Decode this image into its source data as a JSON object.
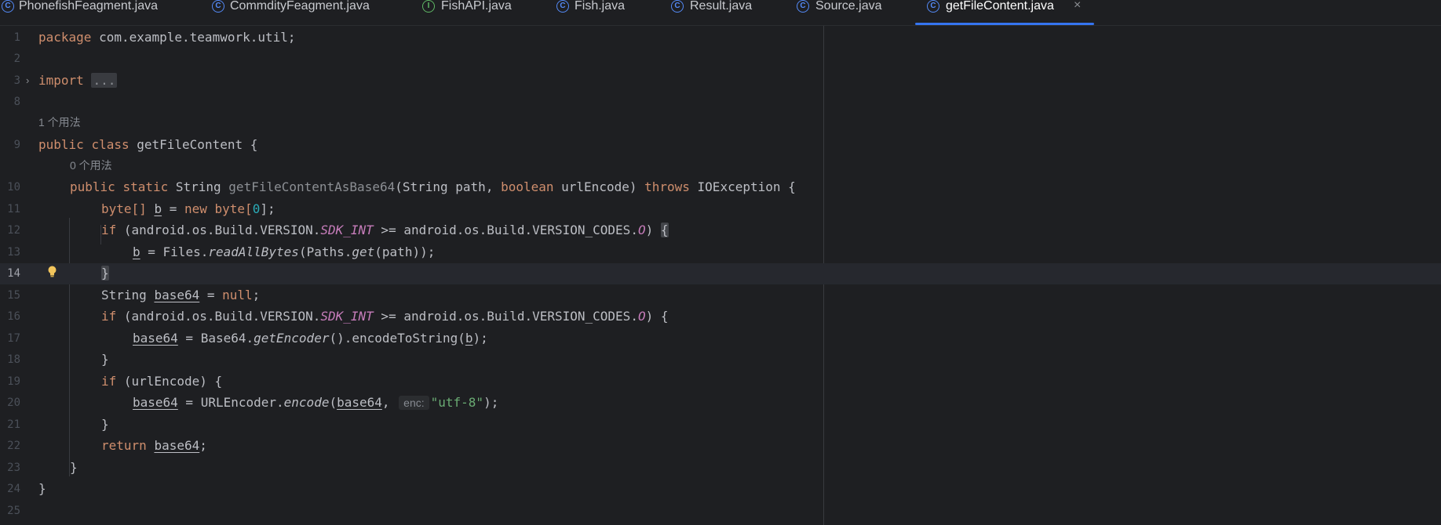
{
  "tabs": [
    {
      "label": "PhonefishFeagment.java",
      "icon": "class-icon",
      "active": false
    },
    {
      "label": "CommdityFeagment.java",
      "icon": "class-icon",
      "active": false
    },
    {
      "label": "FishAPI.java",
      "icon": "interface-icon",
      "active": false
    },
    {
      "label": "Fish.java",
      "icon": "class-icon",
      "active": false
    },
    {
      "label": "Result.java",
      "icon": "class-icon",
      "active": false
    },
    {
      "label": "Source.java",
      "icon": "class-icon",
      "active": false
    },
    {
      "label": "getFileContent.java",
      "icon": "class-icon",
      "active": true
    }
  ],
  "tab_icon_letters": {
    "class": "C",
    "interface": "I"
  },
  "tab_close": "×",
  "line_numbers": [
    "1",
    "2",
    "3",
    "8",
    "9",
    "10",
    "11",
    "12",
    "13",
    "14",
    "15",
    "16",
    "17",
    "18",
    "19",
    "20",
    "21",
    "22",
    "23",
    "24",
    "25"
  ],
  "current_line": "14",
  "hints": {
    "class_usages": "1 个用法",
    "method_usages": "0 个用法"
  },
  "code": {
    "l1_kw": "package",
    "l1_rest": " com.example.teamwork.util;",
    "l3_kw": "import",
    "l3_fold": "...",
    "l9_kw1": "public",
    "l9_kw2": "class",
    "l9_rest": " getFileContent {",
    "l10_kw1": "public",
    "l10_kw2": "static",
    "l10_type": " String ",
    "l10_method": "getFileContentAsBase64",
    "l10_params_a": "(String path, ",
    "l10_kw3": "boolean",
    "l10_params_b": " urlEncode) ",
    "l10_kw4": "throws",
    "l10_rest": " IOException {",
    "l11_a": "byte[] ",
    "l11_var": "b",
    "l11_b": " = ",
    "l11_kw": "new",
    "l11_c": " byte[",
    "l11_num": "0",
    "l11_d": "];",
    "l12_kw": "if",
    "l12_a": " (android.os.Build.VERSION.",
    "l12_static": "SDK_INT",
    "l12_b": " >= android.os.Build.VERSION_CODES.",
    "l12_o": "O",
    "l12_c": ") ",
    "l12_brace": "{",
    "l13_var": "b",
    "l13_a": " = Files.",
    "l13_m1": "readAllBytes",
    "l13_b": "(Paths.",
    "l13_m2": "get",
    "l13_c": "(path));",
    "l14_brace": "}",
    "l15_a": "String ",
    "l15_var": "base64",
    "l15_b": " = ",
    "l15_kw": "null",
    "l15_c": ";",
    "l16_kw": "if",
    "l16_a": " (android.os.Build.VERSION.",
    "l16_static": "SDK_INT",
    "l16_b": " >= android.os.Build.VERSION_CODES.",
    "l16_o": "O",
    "l16_c": ") {",
    "l17_var": "base64",
    "l17_a": " = Base64.",
    "l17_m": "getEncoder",
    "l17_b": "().encodeToString(",
    "l17_var2": "b",
    "l17_c": ");",
    "l18": "}",
    "l19_kw": "if",
    "l19_a": " (urlEncode) {",
    "l20_var": "base64",
    "l20_a": " = URLEncoder.",
    "l20_m": "encode",
    "l20_b": "(",
    "l20_var2": "base64",
    "l20_c": ", ",
    "l20_hint": "enc:",
    "l20_str": "\"utf-8\"",
    "l20_d": ");",
    "l21": "}",
    "l22_kw": "return",
    "l22_a": " ",
    "l22_var": "base64",
    "l22_b": ";",
    "l23": "}",
    "l24": "}"
  },
  "colors": {
    "background": "#1e1f22",
    "keyword": "#cf8e6d",
    "string": "#6aab73",
    "number": "#2aacb8",
    "static_field": "#c77dbb",
    "tab_accent": "#3574f0",
    "class_icon": "#548af7",
    "interface_icon": "#5fb865"
  }
}
